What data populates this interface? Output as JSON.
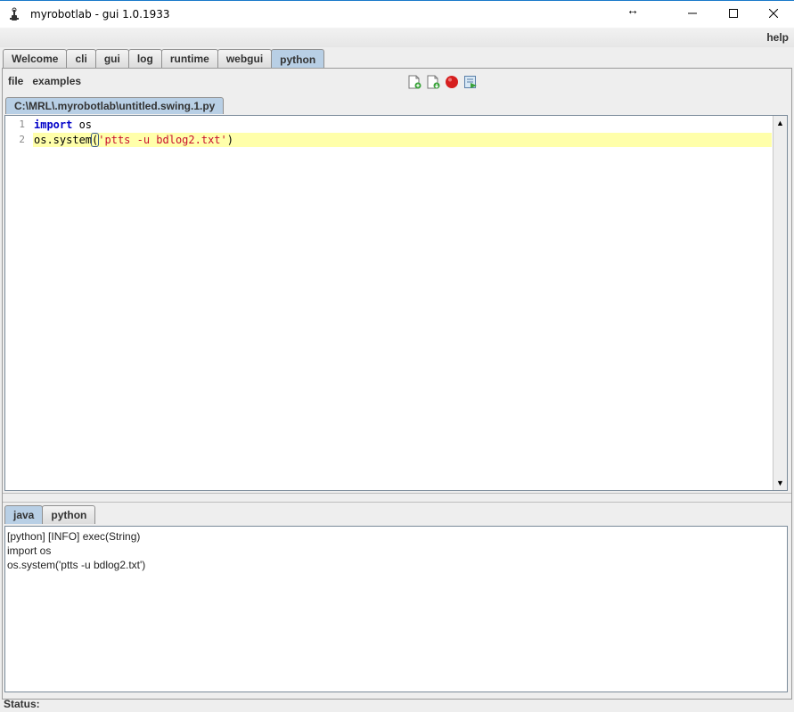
{
  "window": {
    "title": "myrobotlab - gui 1.0.1933",
    "resize_glyph": "↔",
    "help_label": "help"
  },
  "main_tabs": [
    {
      "label": "Welcome",
      "active": false
    },
    {
      "label": "cli",
      "active": false
    },
    {
      "label": "gui",
      "active": false
    },
    {
      "label": "log",
      "active": false
    },
    {
      "label": "runtime",
      "active": false
    },
    {
      "label": "webgui",
      "active": false
    },
    {
      "label": "python",
      "active": true
    }
  ],
  "menu": {
    "file_label": "file",
    "examples_label": "examples"
  },
  "toolbar": {
    "icons": [
      "new-file-icon",
      "open-file-icon",
      "stop-icon",
      "execute-icon"
    ]
  },
  "editor": {
    "file_tab": "C:\\MRL\\.myrobotlab\\untitled.swing.1.py",
    "line_numbers": [
      "1",
      "2"
    ],
    "line1": {
      "keyword": "import",
      "rest": " os"
    },
    "line2": {
      "prefix": "os.system",
      "open_paren": "(",
      "string": "'ptts -u bdlog2.txt'",
      "close_paren": ")"
    }
  },
  "bottom_tabs": [
    {
      "label": "java",
      "active": true
    },
    {
      "label": "python",
      "active": false
    }
  ],
  "console": {
    "lines": [
      "[python] [INFO] exec(String)",
      "import os",
      "os.system('ptts -u bdlog2.txt')"
    ]
  },
  "status": {
    "label": "Status:"
  }
}
